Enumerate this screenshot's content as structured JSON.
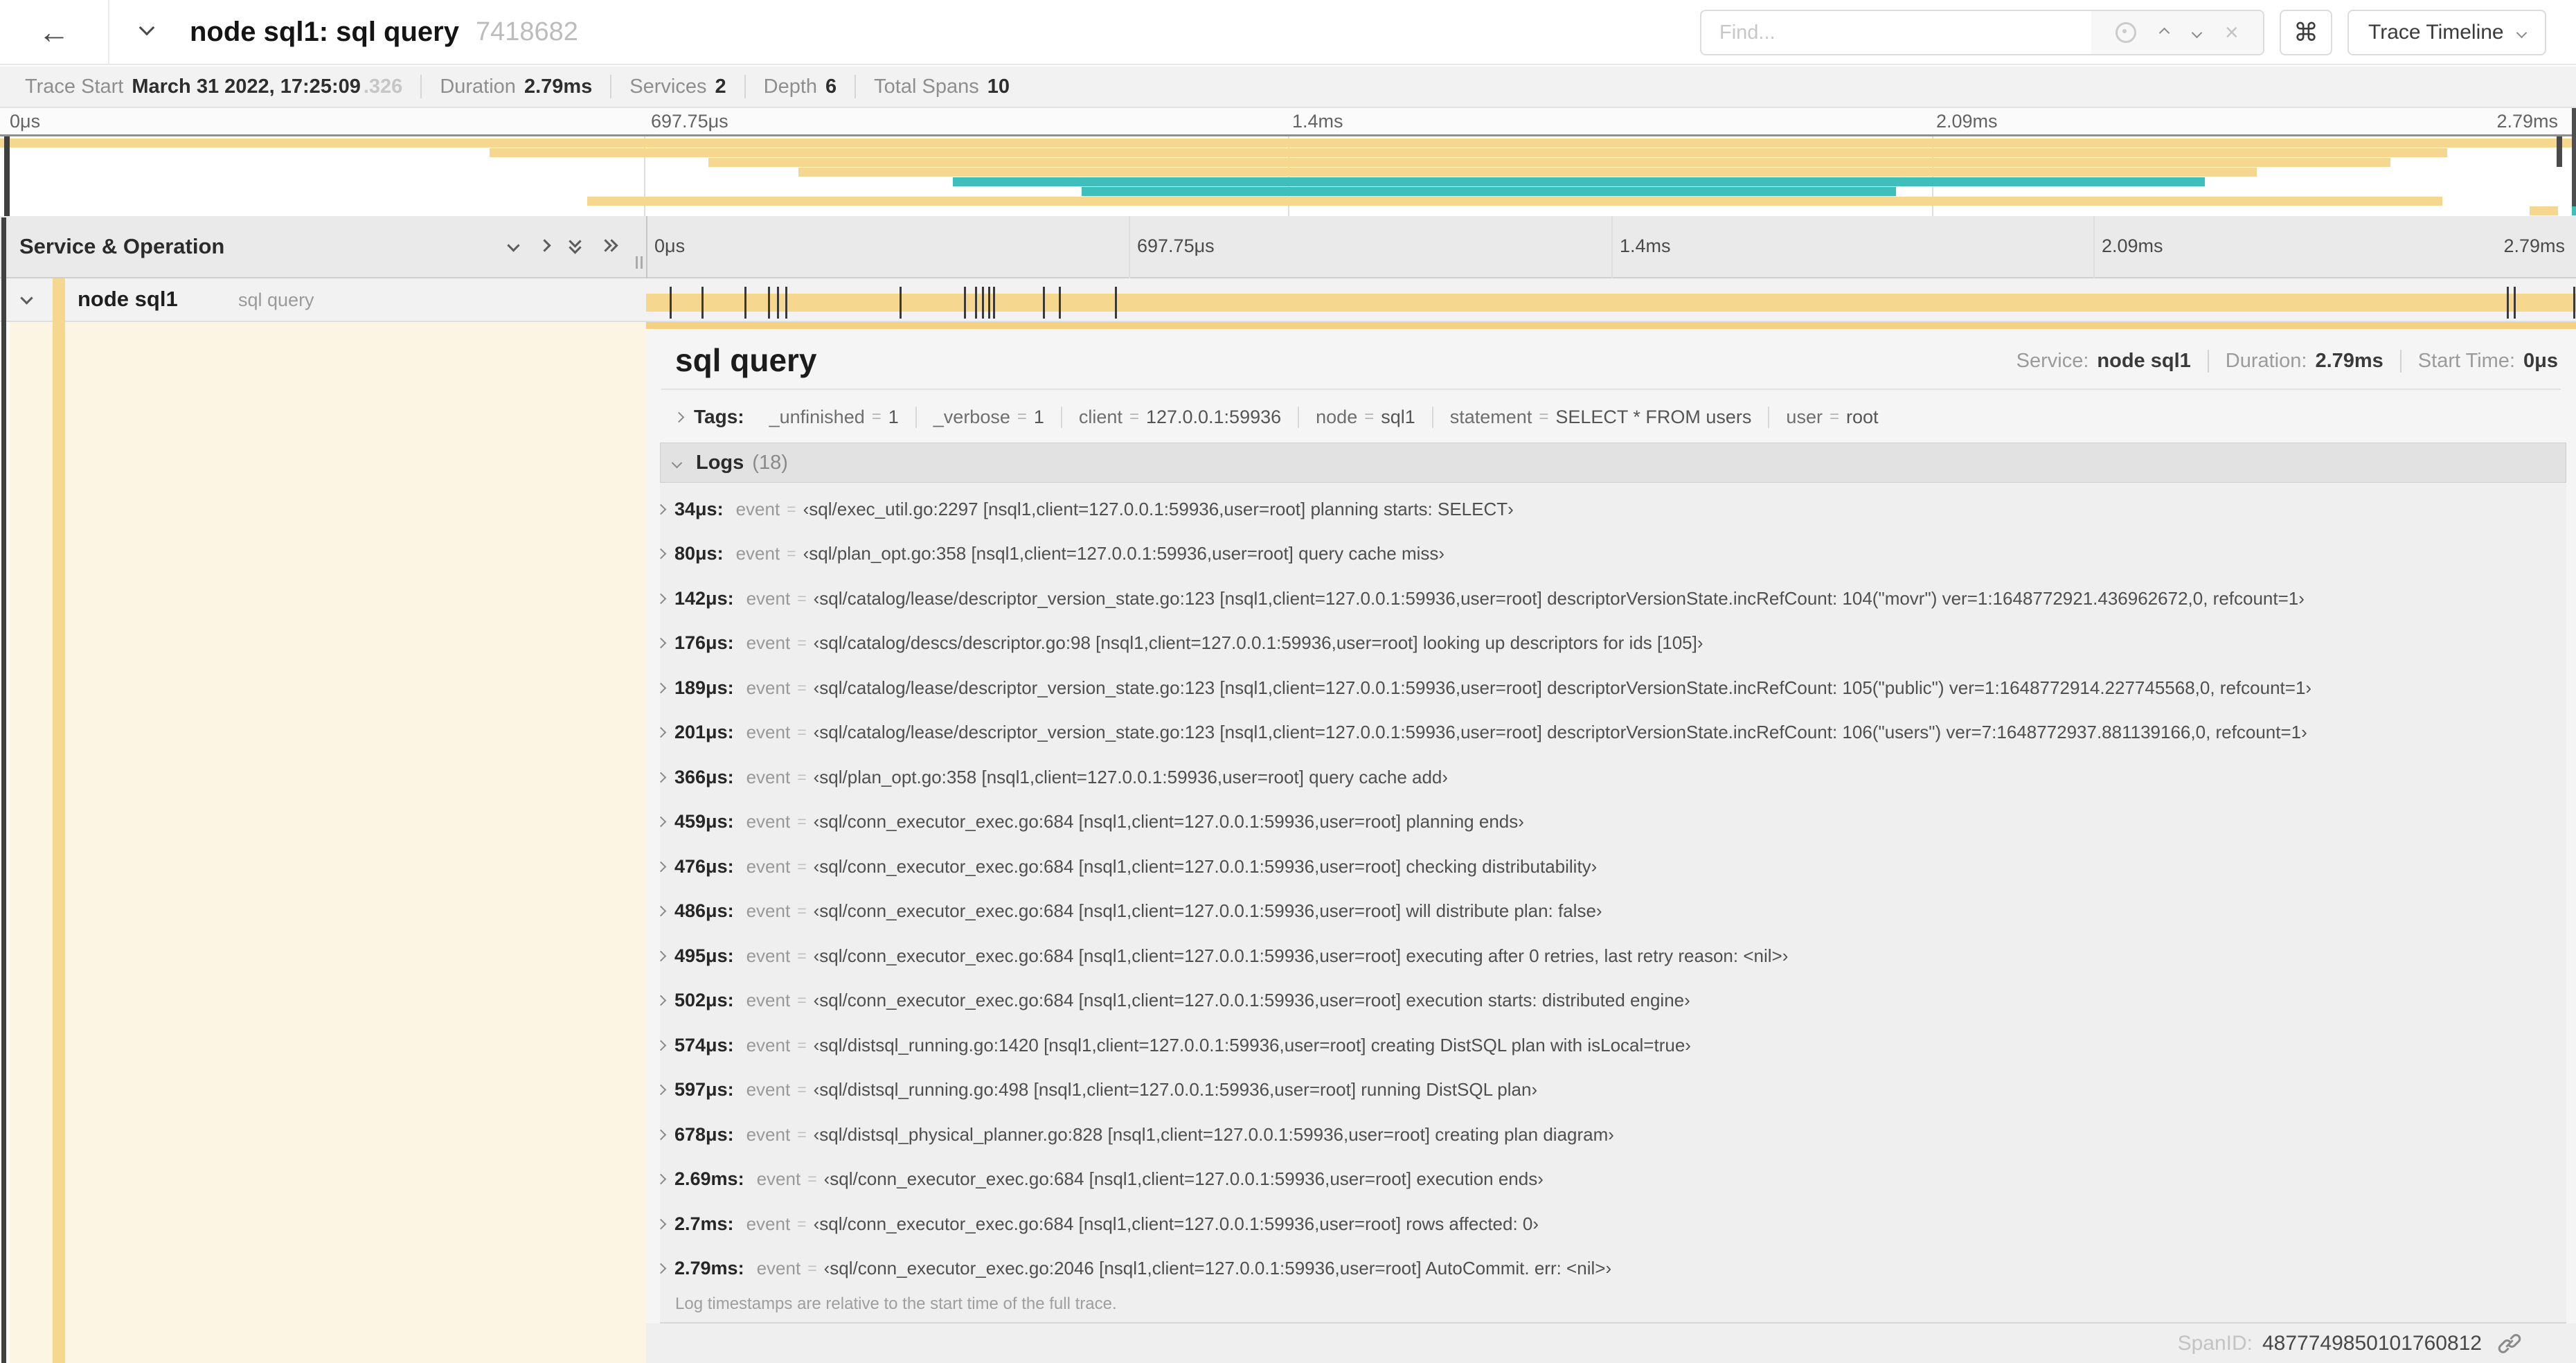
{
  "header": {
    "back_icon": "←",
    "title": "node sql1: sql query",
    "trace_id": "7418682",
    "find_placeholder": "Find...",
    "find_clear_icon": "×",
    "shortcut_key": "⌘",
    "view_selector": "Trace Timeline"
  },
  "summary": {
    "items": [
      {
        "label": "Trace Start",
        "value": "March 31 2022, 17:25:09",
        "suffix": ".326"
      },
      {
        "label": "Duration",
        "value": "2.79ms",
        "suffix": ""
      },
      {
        "label": "Services",
        "value": "2",
        "suffix": ""
      },
      {
        "label": "Depth",
        "value": "6",
        "suffix": ""
      },
      {
        "label": "Total Spans",
        "value": "10",
        "suffix": ""
      }
    ]
  },
  "ruler": {
    "ticks": [
      "0μs",
      "697.75μs",
      "1.4ms",
      "2.09ms",
      "2.79ms"
    ]
  },
  "minimap": {
    "bars": [
      {
        "start": 0,
        "end": 100,
        "color": "#f6d78f"
      },
      {
        "start": 19,
        "end": 95,
        "color": "#f6d78f"
      },
      {
        "start": 27.5,
        "end": 92.8,
        "color": "#f6d78f"
      },
      {
        "start": 31,
        "end": 87.6,
        "color": "#f6d78f"
      },
      {
        "start": 37,
        "end": 85.6,
        "color": "#3fbfbb"
      },
      {
        "start": 42,
        "end": 73.6,
        "color": "#3fbfbb"
      },
      {
        "start": 22.8,
        "end": 94.8,
        "color": "#f6d78f"
      },
      {
        "start": 98.2,
        "end": 99.3,
        "color": "#f6d78f"
      }
    ]
  },
  "span_list": {
    "header": "Service & Operation",
    "row": {
      "service": "node sql1",
      "operation": "sql query"
    },
    "tick_times_us": [
      34,
      80,
      142,
      176,
      189,
      201,
      366,
      459,
      476,
      486,
      495,
      502,
      574,
      597,
      678,
      2690,
      2700,
      2790
    ],
    "total_us": 2790
  },
  "detail": {
    "title": "sql query",
    "eq_sign": "=",
    "meta": [
      {
        "label": "Service:",
        "value": "node sql1"
      },
      {
        "label": "Duration:",
        "value": "2.79ms"
      },
      {
        "label": "Start Time:",
        "value": "0μs"
      }
    ],
    "tags_label": "Tags:",
    "tags": [
      {
        "key": "_unfinished",
        "value": "1"
      },
      {
        "key": "_verbose",
        "value": "1"
      },
      {
        "key": "client",
        "value": "127.0.0.1:59936"
      },
      {
        "key": "node",
        "value": "sql1"
      },
      {
        "key": "statement",
        "value": "SELECT * FROM users"
      },
      {
        "key": "user",
        "value": "root"
      }
    ],
    "logs_label": "Logs",
    "logs_count": "(18)",
    "logs": [
      {
        "time": "34μs:",
        "field": "event",
        "value": "‹sql/exec_util.go:2297 [nsql1,client=127.0.0.1:59936,user=root] planning starts: SELECT›"
      },
      {
        "time": "80μs:",
        "field": "event",
        "value": "‹sql/plan_opt.go:358 [nsql1,client=127.0.0.1:59936,user=root] query cache miss›"
      },
      {
        "time": "142μs:",
        "field": "event",
        "value": "‹sql/catalog/lease/descriptor_version_state.go:123 [nsql1,client=127.0.0.1:59936,user=root] descriptorVersionState.incRefCount: 104(\"movr\") ver=1:1648772921.436962672,0, refcount=1›"
      },
      {
        "time": "176μs:",
        "field": "event",
        "value": "‹sql/catalog/descs/descriptor.go:98 [nsql1,client=127.0.0.1:59936,user=root] looking up descriptors for ids [105]›"
      },
      {
        "time": "189μs:",
        "field": "event",
        "value": "‹sql/catalog/lease/descriptor_version_state.go:123 [nsql1,client=127.0.0.1:59936,user=root] descriptorVersionState.incRefCount: 105(\"public\") ver=1:1648772914.227745568,0, refcount=1›"
      },
      {
        "time": "201μs:",
        "field": "event",
        "value": "‹sql/catalog/lease/descriptor_version_state.go:123 [nsql1,client=127.0.0.1:59936,user=root] descriptorVersionState.incRefCount: 106(\"users\") ver=7:1648772937.881139166,0, refcount=1›"
      },
      {
        "time": "366μs:",
        "field": "event",
        "value": "‹sql/plan_opt.go:358 [nsql1,client=127.0.0.1:59936,user=root] query cache add›"
      },
      {
        "time": "459μs:",
        "field": "event",
        "value": "‹sql/conn_executor_exec.go:684 [nsql1,client=127.0.0.1:59936,user=root] planning ends›"
      },
      {
        "time": "476μs:",
        "field": "event",
        "value": "‹sql/conn_executor_exec.go:684 [nsql1,client=127.0.0.1:59936,user=root] checking distributability›"
      },
      {
        "time": "486μs:",
        "field": "event",
        "value": "‹sql/conn_executor_exec.go:684 [nsql1,client=127.0.0.1:59936,user=root] will distribute plan: false›"
      },
      {
        "time": "495μs:",
        "field": "event",
        "value": "‹sql/conn_executor_exec.go:684 [nsql1,client=127.0.0.1:59936,user=root] executing after 0 retries, last retry reason: <nil>›"
      },
      {
        "time": "502μs:",
        "field": "event",
        "value": "‹sql/conn_executor_exec.go:684 [nsql1,client=127.0.0.1:59936,user=root] execution starts: distributed engine›"
      },
      {
        "time": "574μs:",
        "field": "event",
        "value": "‹sql/distsql_running.go:1420 [nsql1,client=127.0.0.1:59936,user=root] creating DistSQL plan with isLocal=true›"
      },
      {
        "time": "597μs:",
        "field": "event",
        "value": "‹sql/distsql_running.go:498 [nsql1,client=127.0.0.1:59936,user=root] running DistSQL plan›"
      },
      {
        "time": "678μs:",
        "field": "event",
        "value": "‹sql/distsql_physical_planner.go:828 [nsql1,client=127.0.0.1:59936,user=root] creating plan diagram›"
      },
      {
        "time": "2.69ms:",
        "field": "event",
        "value": "‹sql/conn_executor_exec.go:684 [nsql1,client=127.0.0.1:59936,user=root] execution ends›"
      },
      {
        "time": "2.7ms:",
        "field": "event",
        "value": "‹sql/conn_executor_exec.go:684 [nsql1,client=127.0.0.1:59936,user=root] rows affected: 0›"
      },
      {
        "time": "2.79ms:",
        "field": "event",
        "value": "‹sql/conn_executor_exec.go:2046 [nsql1,client=127.0.0.1:59936,user=root] AutoCommit. err: <nil>›"
      }
    ],
    "note": "Log timestamps are relative to the start time of the full trace.",
    "footer": {
      "label": "SpanID:",
      "value": "4877749850101760812"
    }
  },
  "colors": {
    "span_yellow": "#f6d78f",
    "span_teal": "#3fbfbb",
    "detail_cream": "#fcf5e4",
    "accent_band": "#f4d083"
  }
}
